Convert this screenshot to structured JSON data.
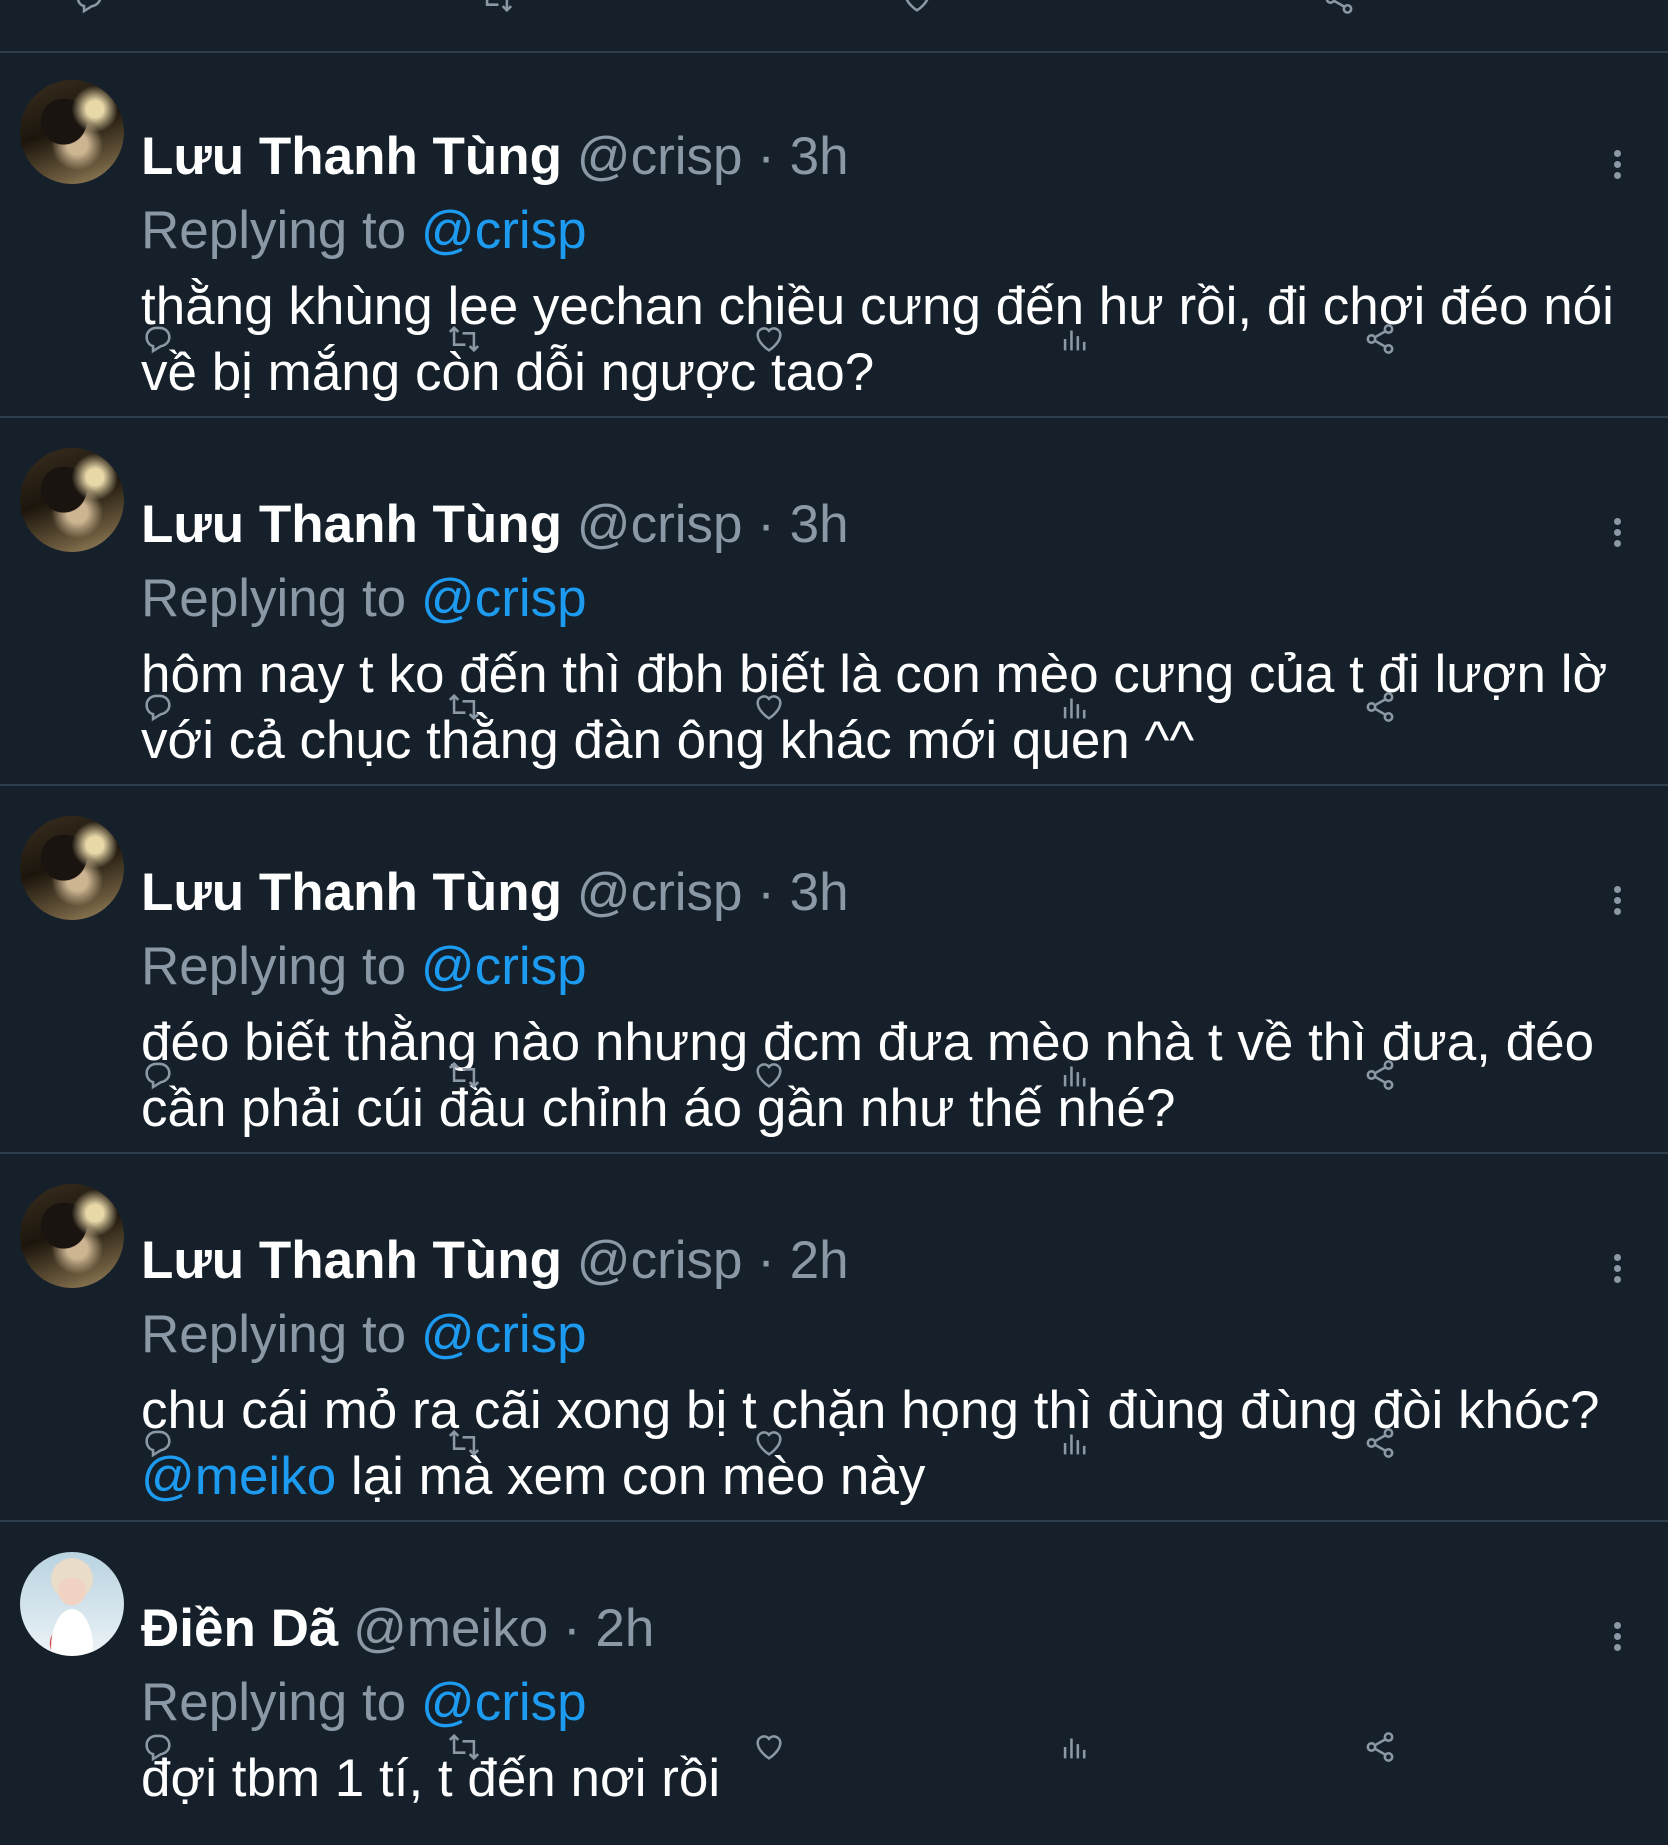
{
  "colors": {
    "background": "#15202b",
    "divider": "#2f3e4d",
    "secondary_text": "#8b98a5",
    "mention": "#1d9bf0",
    "primary_text": "#ffffff"
  },
  "tweets": [
    {
      "name": "Lưu Thanh Tùng",
      "handle": "@crisp",
      "separator": "·",
      "time": "3h",
      "replying_prefix": "Replying to",
      "replying_to": "@crisp",
      "text": "thằng khùng lee yechan chiều cưng đến hư rồi, đi chơi đéo nói về bị mắng còn dỗi ngược tao?",
      "avatar": "avatar-lưu-thanh-tùng"
    },
    {
      "name": "Lưu Thanh Tùng",
      "handle": "@crisp",
      "separator": "·",
      "time": "3h",
      "replying_prefix": "Replying to",
      "replying_to": "@crisp",
      "text": "hôm nay t ko đến thì đbh biết là con mèo cưng của t đi lượn lờ với cả chục thằng đàn ông khác mới quen ^^",
      "avatar": "avatar-lưu-thanh-tùng"
    },
    {
      "name": "Lưu Thanh Tùng",
      "handle": "@crisp",
      "separator": "·",
      "time": "3h",
      "replying_prefix": "Replying to",
      "replying_to": "@crisp",
      "text": "đéo biết thằng nào nhưng đcm đưa mèo nhà t về thì đưa, đéo cần phải cúi đầu chỉnh áo gần như thế nhé?",
      "avatar": "avatar-lưu-thanh-tùng"
    },
    {
      "name": "Lưu Thanh Tùng",
      "handle": "@crisp",
      "separator": "·",
      "time": "2h",
      "replying_prefix": "Replying to",
      "replying_to": "@crisp",
      "text_before": "chu cái mỏ ra cãi xong bị t chặn họng thì đùng đùng đòi khóc? ",
      "text_mention": "@meiko",
      "text_after": " lại mà xem con mèo này",
      "avatar": "avatar-lưu-thanh-tùng"
    },
    {
      "name": "Điền Dã",
      "handle": "@meiko",
      "separator": "·",
      "time": "2h",
      "replying_prefix": "Replying to",
      "replying_to": "@crisp",
      "text": "đợi tbm 1 tí, t đến nơi rồi",
      "avatar": "avatar-điền-dã"
    }
  ],
  "icons": {
    "reply": "reply-icon",
    "retweet": "retweet-icon",
    "like": "heart-icon",
    "views": "views-icon",
    "share": "share-icon",
    "more": "more-icon"
  }
}
